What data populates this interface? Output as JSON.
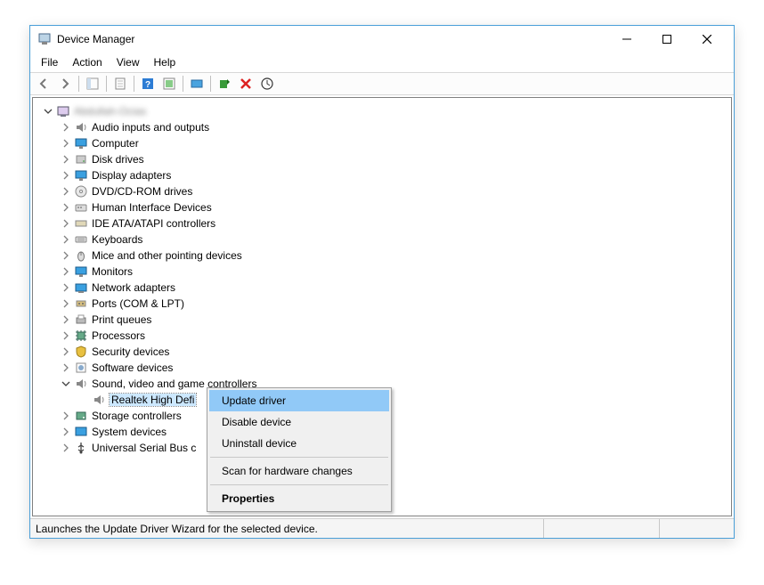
{
  "window": {
    "title": "Device Manager"
  },
  "menubar": {
    "file": "File",
    "action": "Action",
    "view": "View",
    "help": "Help"
  },
  "tree": {
    "root": "Abdullah-Ocias",
    "nodes": [
      {
        "label": "Audio inputs and outputs",
        "icon": "speaker"
      },
      {
        "label": "Computer",
        "icon": "monitor"
      },
      {
        "label": "Disk drives",
        "icon": "disk"
      },
      {
        "label": "Display adapters",
        "icon": "monitor"
      },
      {
        "label": "DVD/CD-ROM drives",
        "icon": "cd"
      },
      {
        "label": "Human Interface Devices",
        "icon": "hid"
      },
      {
        "label": "IDE ATA/ATAPI controllers",
        "icon": "ide"
      },
      {
        "label": "Keyboards",
        "icon": "keyboard"
      },
      {
        "label": "Mice and other pointing devices",
        "icon": "mouse"
      },
      {
        "label": "Monitors",
        "icon": "monitor"
      },
      {
        "label": "Network adapters",
        "icon": "network"
      },
      {
        "label": "Ports (COM & LPT)",
        "icon": "port"
      },
      {
        "label": "Print queues",
        "icon": "printer"
      },
      {
        "label": "Processors",
        "icon": "cpu"
      },
      {
        "label": "Security devices",
        "icon": "security"
      },
      {
        "label": "Software devices",
        "icon": "software"
      },
      {
        "label": "Sound, video and game controllers",
        "icon": "speaker",
        "expanded": true
      },
      {
        "label": "Storage controllers",
        "icon": "storage"
      },
      {
        "label": "System devices",
        "icon": "system"
      },
      {
        "label": "Universal Serial Bus controllers",
        "icon": "usb",
        "truncated": "Universal Serial Bus c"
      }
    ],
    "selected_child": "Realtek High Definition Audio",
    "selected_child_truncated": "Realtek High Defi"
  },
  "context_menu": {
    "items": [
      {
        "label": "Update driver",
        "highlighted": true
      },
      {
        "label": "Disable device"
      },
      {
        "label": "Uninstall device"
      },
      {
        "sep": true
      },
      {
        "label": "Scan for hardware changes"
      },
      {
        "sep": true
      },
      {
        "label": "Properties",
        "bold": true
      }
    ]
  },
  "statusbar": {
    "text": "Launches the Update Driver Wizard for the selected device."
  }
}
